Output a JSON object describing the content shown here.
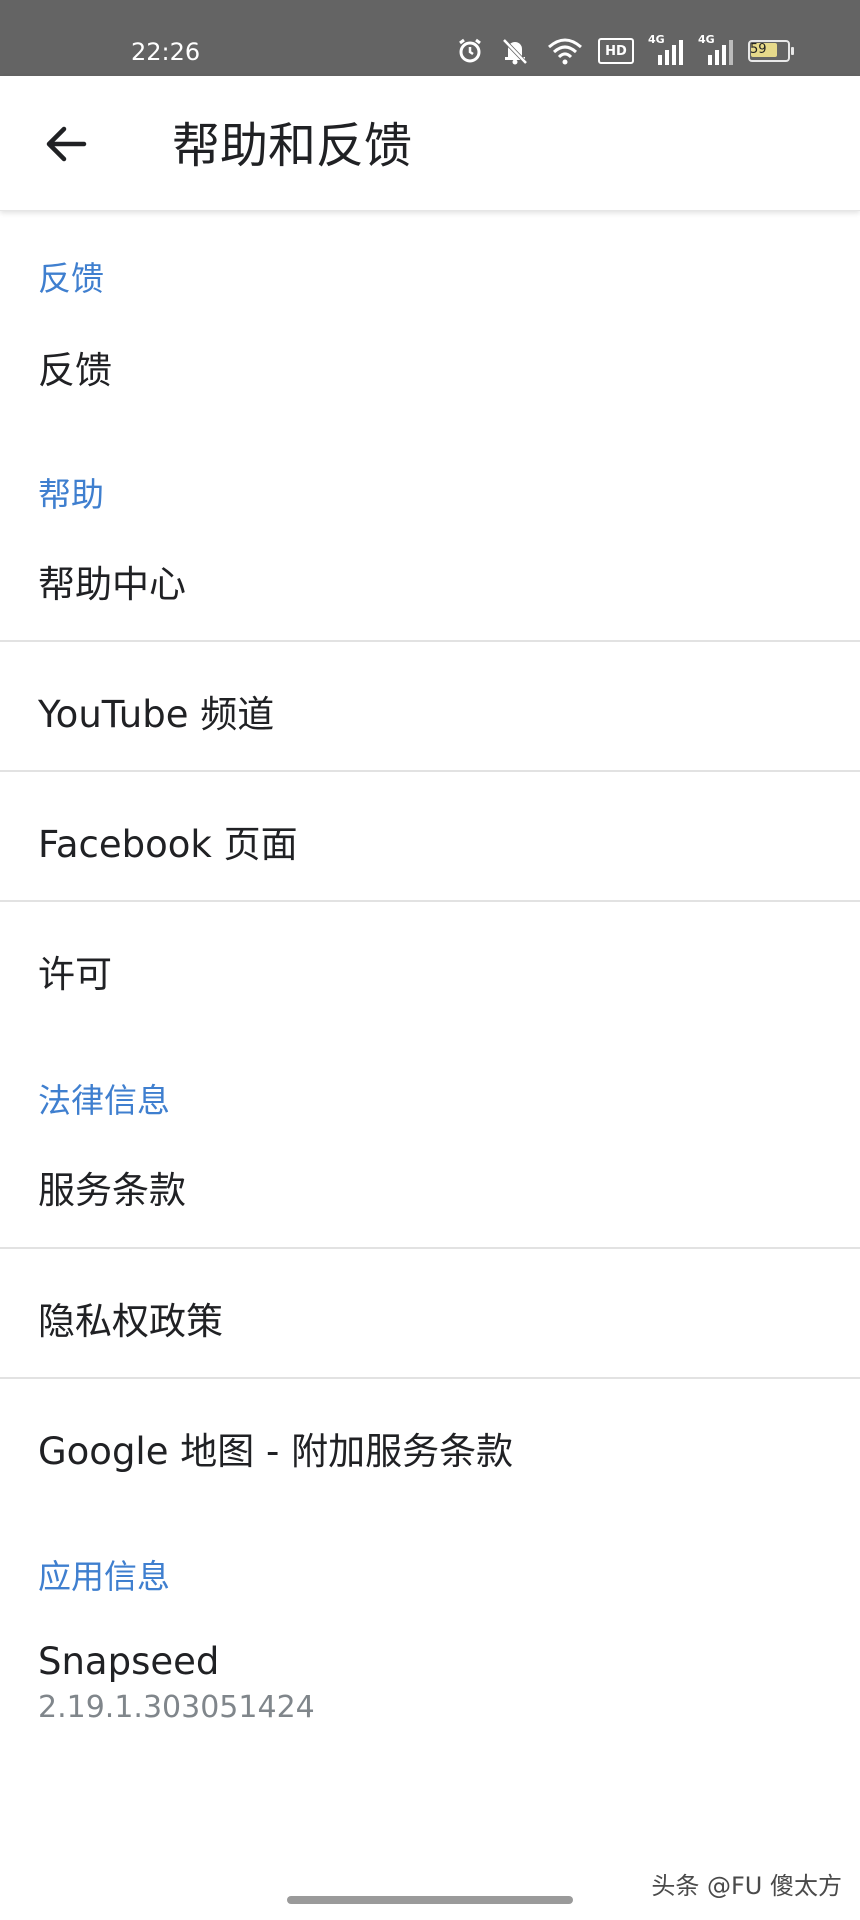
{
  "status_bar": {
    "time": "22:26",
    "hd_label": "HD",
    "net1": "4G",
    "net2": "4G",
    "battery": "59",
    "icons": [
      "alarm-icon",
      "mute-icon",
      "wifi-icon",
      "hd-icon",
      "signal-icon",
      "signal-icon",
      "battery-icon"
    ]
  },
  "app_bar": {
    "title": "帮助和反馈",
    "back_icon": "arrow-left-icon"
  },
  "sections": {
    "feedback": {
      "header": "反馈",
      "item": "反馈"
    },
    "help": {
      "header": "帮助",
      "items": [
        "帮助中心",
        "YouTube 频道",
        "Facebook 页面",
        "许可"
      ]
    },
    "legal": {
      "header": "法律信息",
      "items": [
        "服务条款",
        "隐私权政策",
        "Google 地图 - 附加服务条款"
      ]
    },
    "app_info": {
      "header": "应用信息",
      "name": "Snapseed",
      "version": "2.19.1.303051424"
    }
  },
  "watermark": "头条 @FU 傻太方",
  "colors": {
    "accent": "#3f7fcf",
    "text": "#202124",
    "subtext": "#80868b",
    "statusbar": "#646464"
  }
}
